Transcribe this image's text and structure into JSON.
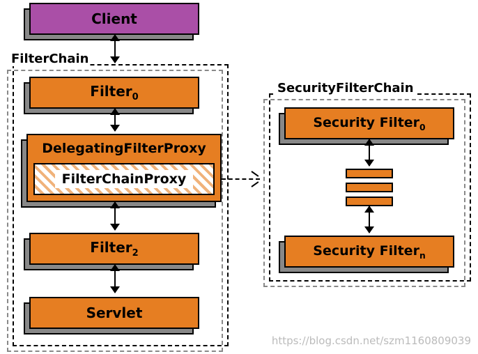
{
  "left": {
    "chainLabel": "FilterChain",
    "client": "Client",
    "filter0": "Filter",
    "filter0_sub": "0",
    "delegating": "DelegatingFilterProxy",
    "fcp": "FilterChainProxy",
    "filter2": "Filter",
    "filter2_sub": "2",
    "servlet": "Servlet"
  },
  "right": {
    "chainLabel": "SecurityFilterChain",
    "secFilter0": "Security Filter",
    "secFilter0_sub": "0",
    "secFilterN": "Security Filter",
    "secFilterN_sub": "n"
  },
  "watermark": "https://blog.csdn.net/szm1160809039",
  "colors": {
    "purple": "#aa4fa7",
    "orange": "#e67e22"
  }
}
